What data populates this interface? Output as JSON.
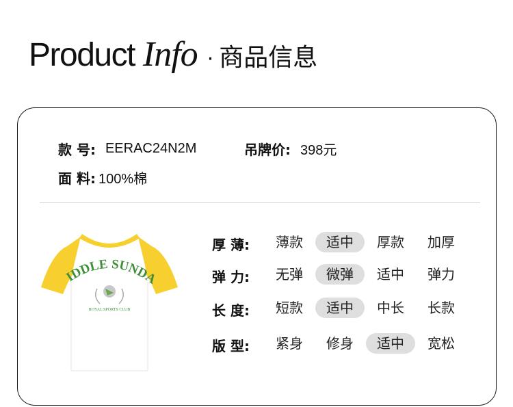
{
  "header": {
    "title_product": "Product",
    "title_info": "Info",
    "separator": "·",
    "title_cn": "商品信息"
  },
  "info": {
    "style_no_label": "款 号:",
    "style_no_value": "EERAC24N2M",
    "price_label": "吊牌价:",
    "price_value": "398元",
    "fabric_label": "面 料:",
    "fabric_value": "100%棉"
  },
  "product_image": {
    "print_main": "MIDDLE SUNDAY",
    "print_sub": "ROYAL SPORTS CLUB",
    "sleeve_color": "#f7cf2f",
    "body_color": "#ffffff",
    "print_color": "#3f8f3a"
  },
  "attributes": [
    {
      "label": "厚 薄:",
      "options": [
        "薄款",
        "适中",
        "厚款",
        "加厚"
      ],
      "selected": 1
    },
    {
      "label": "弹 力:",
      "options": [
        "无弹",
        "微弹",
        "适中",
        "弹力"
      ],
      "selected": 1
    },
    {
      "label": "长 度:",
      "options": [
        "短款",
        "适中",
        "中长",
        "长款"
      ],
      "selected": 1
    },
    {
      "label": "版 型:",
      "options": [
        "紧身",
        "修身",
        "适中",
        "宽松"
      ],
      "selected": 2
    }
  ],
  "colors": {
    "selected_pill": "#dedede",
    "border": "#1a1a1a",
    "divider": "#cfcfcf"
  }
}
